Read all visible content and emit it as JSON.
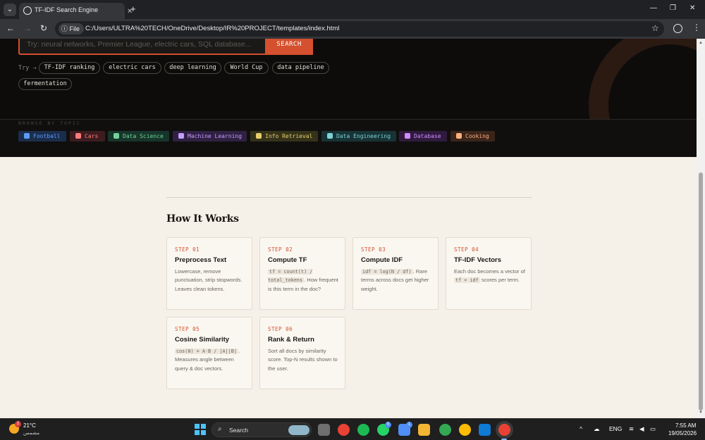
{
  "browser": {
    "tab_title": "TF-IDF Search Engine",
    "tab_list_icon": "chevron-down-icon",
    "close_tab_icon": "close-icon",
    "new_tab_glyph": "+",
    "window_minimize": "—",
    "window_restore": "❐",
    "window_close": "✕",
    "back": "←",
    "forward": "→",
    "reload": "↻",
    "file_chip": "File",
    "url": "C:/Users/ULTRA%20TECH/OneDrive/Desktop/IR%20PROJECT/templates/index.html",
    "star": "☆",
    "menu": "⋮"
  },
  "hero": {
    "search_placeholder": "Try: neural networks, Premier League, electric cars, SQL database...",
    "search_button": "SEARCH",
    "try_label": "Try →",
    "suggestions": [
      "TF-IDF ranking",
      "electric cars",
      "deep learning",
      "World Cup",
      "data pipeline",
      "fermentation"
    ]
  },
  "browse": {
    "label": "BROWSE BY TOPIC",
    "topics": [
      {
        "label": "Football",
        "icon": "football-icon",
        "color": "#5b9bff",
        "bg": "#1b2d4a"
      },
      {
        "label": "Cars",
        "icon": "car-icon",
        "color": "#ff7b7b",
        "bg": "#3d1c1f"
      },
      {
        "label": "Data Science",
        "icon": "chart-icon",
        "color": "#6fd39a",
        "bg": "#17352a"
      },
      {
        "label": "Machine Learning",
        "icon": "robot-icon",
        "color": "#c79bff",
        "bg": "#2f2142"
      },
      {
        "label": "Info Retrieval",
        "icon": "search-icon",
        "color": "#e6cf6b",
        "bg": "#35321a"
      },
      {
        "label": "Data Engineering",
        "icon": "gear-icon",
        "color": "#7fd1d8",
        "bg": "#173335"
      },
      {
        "label": "Database",
        "icon": "database-icon",
        "color": "#d08cff",
        "bg": "#2f1a3d"
      },
      {
        "label": "Cooking",
        "icon": "cooking-icon",
        "color": "#ffb07a",
        "bg": "#3a251b"
      }
    ]
  },
  "how": {
    "title": "How It Works",
    "cards": [
      {
        "step": "STEP 01",
        "title": "Preprocess Text",
        "desc": "Lowercase, remove punctuation, strip stopwords. Leaves clean tokens."
      },
      {
        "step": "STEP 02",
        "title": "Compute TF",
        "code": "tf = count(t) / total_tokens",
        "desc": ". How frequent is this term in the doc?"
      },
      {
        "step": "STEP 03",
        "title": "Compute IDF",
        "code": "idf = log(N / df)",
        "desc": ". Rare terms across docs get higher weight."
      },
      {
        "step": "STEP 04",
        "title": "TF-IDF Vectors",
        "pre": "Each doc becomes a vector of ",
        "code": "tf × idf",
        "desc": " scores per term."
      },
      {
        "step": "STEP 05",
        "title": "Cosine Similarity",
        "code": "cos(θ) = A·B / |A||B|",
        "desc": ". Measures angle between query & doc vectors."
      },
      {
        "step": "STEP 06",
        "title": "Rank & Return",
        "desc": "Sort all docs by similarity score. Top-N results shown to the user."
      }
    ]
  },
  "taskbar": {
    "weather_badge": "2",
    "temperature": "21°C",
    "weather_desc": "مشمس",
    "search": "Search",
    "badge_whatsapp": "5",
    "badge_store": "1",
    "language": "ENG",
    "time": "7:55 AM",
    "date": "19/05/2026"
  }
}
